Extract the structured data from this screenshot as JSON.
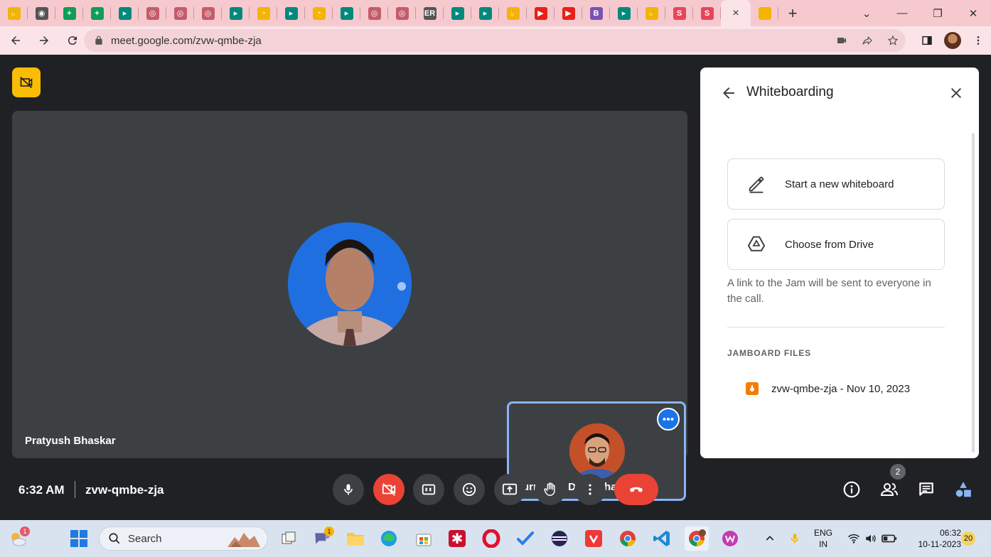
{
  "browser": {
    "url": "meet.google.com/zvw-qmbe-zja",
    "tab_close_glyph": "×",
    "new_tab_glyph": "+",
    "window_controls": [
      "⌄",
      "—",
      "❐",
      "✕"
    ],
    "tabs": [
      {
        "icon": "jamboard-icon",
        "color": "#f4b400"
      },
      {
        "icon": "chrome-icon",
        "color": "#555555"
      },
      {
        "icon": "sheets-icon",
        "color": "#0f9d58"
      },
      {
        "icon": "sheets-icon",
        "color": "#0f9d58"
      },
      {
        "icon": "meet-icon",
        "color": "#00897b"
      },
      {
        "icon": "globe-icon",
        "color": "#c45c6a"
      },
      {
        "icon": "globe-icon",
        "color": "#c45c6a"
      },
      {
        "icon": "compass-icon",
        "color": "#c45c6a"
      },
      {
        "icon": "meet-icon",
        "color": "#00897b"
      },
      {
        "icon": "clock-icon",
        "color": "#f4b400"
      },
      {
        "icon": "meet-icon",
        "color": "#00897b"
      },
      {
        "icon": "clock-icon",
        "color": "#f4b400"
      },
      {
        "icon": "meet-icon",
        "color": "#00897b"
      },
      {
        "icon": "globe-icon",
        "color": "#c45c6a"
      },
      {
        "icon": "globe-icon",
        "color": "#c45c6a"
      },
      {
        "icon": "er-icon",
        "color": "#555555"
      },
      {
        "icon": "meet-icon",
        "color": "#00897b"
      },
      {
        "icon": "meet-icon",
        "color": "#00897b"
      },
      {
        "icon": "jamboard-icon",
        "color": "#f4b400"
      },
      {
        "icon": "youtube-icon",
        "color": "#e62117"
      },
      {
        "icon": "youtube-icon",
        "color": "#e62117"
      },
      {
        "icon": "bootstrap-icon",
        "color": "#7952b3"
      },
      {
        "icon": "meet-icon",
        "color": "#00897b"
      },
      {
        "icon": "jamboard-icon",
        "color": "#f4b400"
      },
      {
        "icon": "s-icon",
        "color": "#e8455a"
      },
      {
        "icon": "s-icon",
        "color": "#e8455a"
      }
    ],
    "active_tab_icon": "close-icon",
    "last_tab_icon": "jamboard-icon"
  },
  "meet": {
    "main_participant": "Pratyush Bhaskar",
    "self_participant": "Purnendu Dutta Jha",
    "time": "6:32 AM",
    "meeting_code": "zvw-qmbe-zja",
    "people_count": "2",
    "colors": {
      "accent": "#1a73e8",
      "danger": "#ea4335",
      "cam_off_badge": "#fbbc04"
    }
  },
  "panel": {
    "title": "Whiteboarding",
    "start_new": "Start a new whiteboard",
    "choose_drive": "Choose from Drive",
    "note": "A link to the Jam will be sent to everyone in the call.",
    "files_header": "JAMBOARD FILES",
    "files": [
      {
        "name": "zvw-qmbe-zja - Nov 10, 2023"
      }
    ]
  },
  "taskbar": {
    "search_label": "Search",
    "weather_badge": "1",
    "chat_badge": "1",
    "lang_line1": "ENG",
    "lang_line2": "IN",
    "clock_time": "06:32",
    "clock_date": "10-11-2023",
    "notification_count": "20"
  }
}
